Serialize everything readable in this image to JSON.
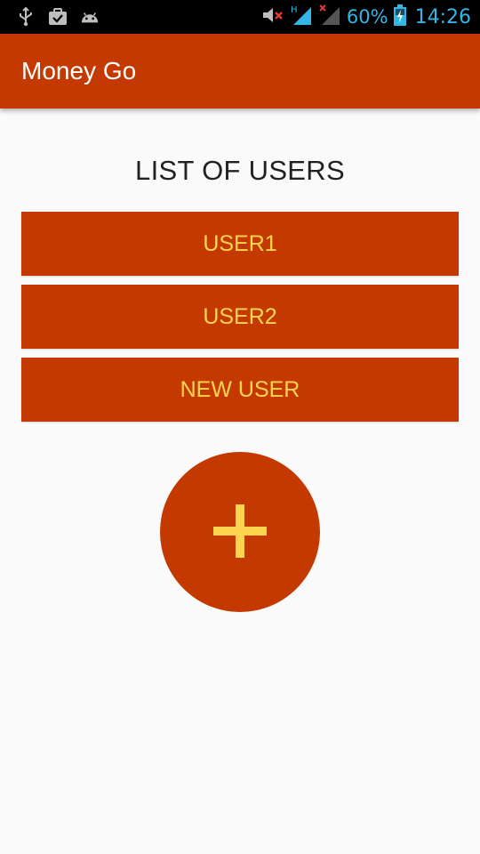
{
  "status_bar": {
    "icons_left": [
      "usb-icon",
      "briefcase-check-icon",
      "android-icon"
    ],
    "icons_right": [
      "volume-muted-icon",
      "signal-h-icon",
      "signal-no-sim-icon",
      "battery-charging-icon"
    ],
    "battery_percent": "60%",
    "time": "14:26",
    "accent_color": "#33b5e5"
  },
  "app_bar": {
    "title": "Money Go",
    "color": "#c43900"
  },
  "main": {
    "list_title": "LIST OF USERS",
    "users": [
      {
        "label": "USER1"
      },
      {
        "label": "USER2"
      },
      {
        "label": "NEW USER"
      }
    ],
    "button_text_color": "#ffd54f",
    "fab_icon": "plus-icon"
  }
}
